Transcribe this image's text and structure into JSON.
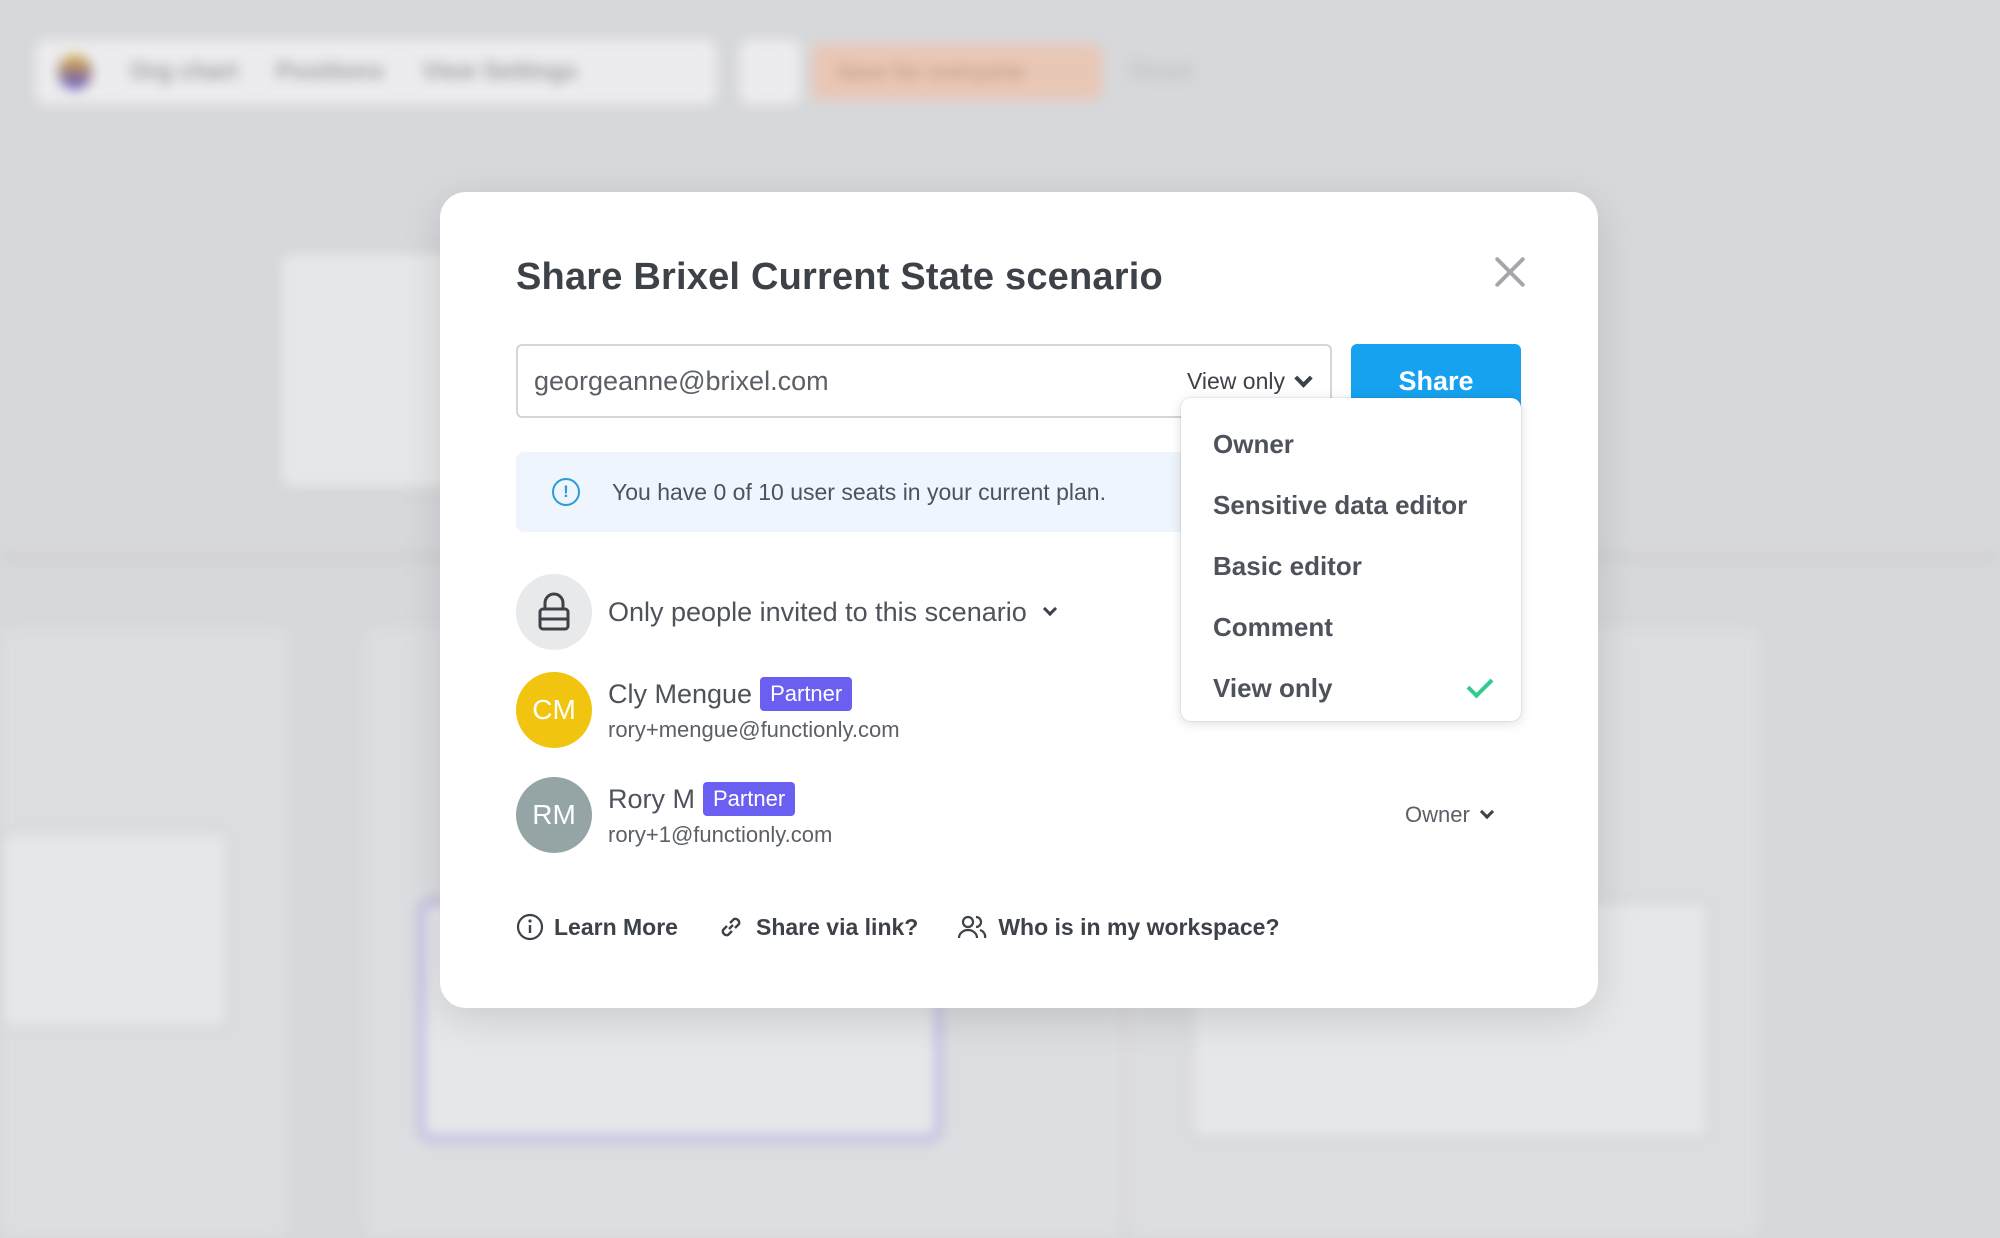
{
  "background": {
    "toolbar": {
      "items": [
        "Org chart",
        "Positions",
        "View Settings"
      ],
      "save_label": "Save for everyone",
      "reset_label": "Reset"
    }
  },
  "modal": {
    "title": "Share Brixel Current State scenario",
    "email_value": "georgeanne@brixel.com",
    "permission_selected": "View only",
    "share_label": "Share",
    "info_text": "You have 0 of 10 user seats in your current plan.",
    "access_label": "Only people invited to this scenario",
    "members": [
      {
        "initials": "CM",
        "name": "Cly Mengue",
        "badge": "Partner",
        "email": "rory+mengue@functionly.com",
        "avatar_color": "#f1c40f"
      },
      {
        "initials": "RM",
        "name": "Rory M",
        "badge": "Partner",
        "email": "rory+1@functionly.com",
        "avatar_color": "#95a5a6",
        "role": "Owner"
      }
    ],
    "footer": {
      "learn_more": "Learn More",
      "share_link": "Share via link?",
      "workspace": "Who is in my workspace?"
    }
  },
  "dropdown": {
    "options": [
      "Owner",
      "Sensitive data editor",
      "Basic editor",
      "Comment",
      "View only"
    ],
    "selected": "View only"
  },
  "colors": {
    "accent": "#16a2ef",
    "badge": "#6b5ff2",
    "info_bg": "#eef5fc",
    "check": "#2ecc8f"
  }
}
